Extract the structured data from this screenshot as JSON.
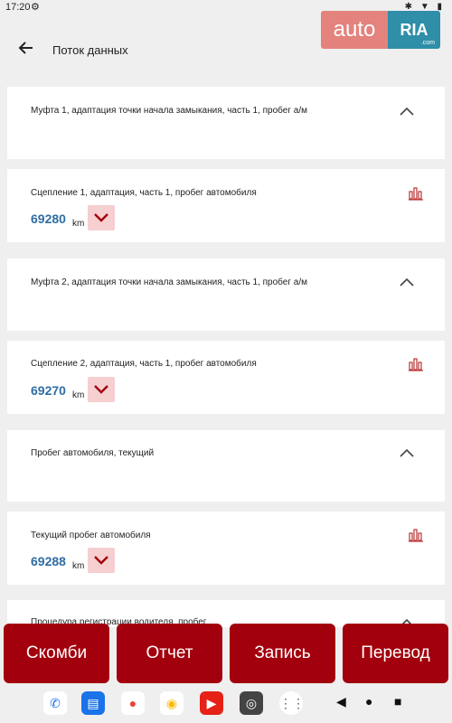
{
  "status": {
    "time": "17:20",
    "icons": "✱ ▼ ▮"
  },
  "appbar": {
    "title": "Поток данных"
  },
  "logo": {
    "part1": "auto",
    "part2": "RIA",
    "suffix": ".com"
  },
  "items": [
    {
      "label": "Муфта 1, адаптация точки начала замыкания, часть 1, пробег а/м"
    },
    {
      "label": "Сцепление 1, адаптация, часть 1, пробег автомобиля",
      "value": "69280",
      "unit": "km"
    },
    {
      "label": "Муфта 2, адаптация точки начала замыкания, часть 1, пробег а/м"
    },
    {
      "label": "Сцепление 2, адаптация, часть 1, пробег автомобиля",
      "value": "69270",
      "unit": "km"
    },
    {
      "label": "Пробег автомобиля, текущий"
    },
    {
      "label": "Текущий пробег автомобиля",
      "value": "69288",
      "unit": "km"
    },
    {
      "label": "Процедура регистрации водителя, пробег"
    }
  ],
  "bottom_buttons": [
    "Скомби",
    "Отчет",
    "Запись",
    "Перевод"
  ],
  "colors": {
    "accent": "#a3000d",
    "value": "#2e6da4",
    "dropdown_bg": "#f6cfd0"
  }
}
